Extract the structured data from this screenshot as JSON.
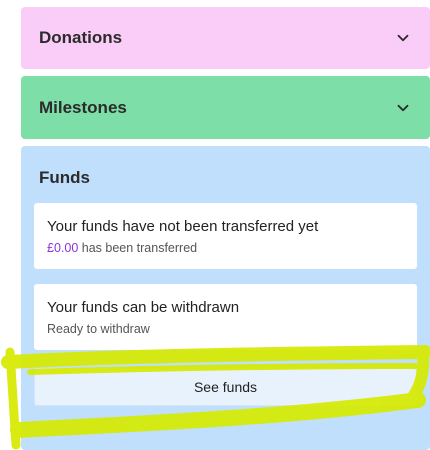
{
  "sections": {
    "donations": {
      "title": "Donations",
      "icon": "chevron-down-icon"
    },
    "milestones": {
      "title": "Milestones",
      "icon": "chevron-down-icon"
    },
    "funds": {
      "title": "Funds",
      "transfer_card": {
        "heading": "Your funds have not been transferred yet",
        "amount": "£0.00",
        "amount_suffix": " has been transferred"
      },
      "withdraw_card": {
        "heading": "Your funds can be withdrawn",
        "status": "Ready to withdraw"
      },
      "see_funds_label": "See funds"
    }
  },
  "colors": {
    "donations_bg": "#f9cdf7",
    "milestones_bg": "#7ddea8",
    "funds_bg": "#bfdffc",
    "accent_text": "#8a35d6",
    "highlight_marker": "#d6ea00"
  }
}
